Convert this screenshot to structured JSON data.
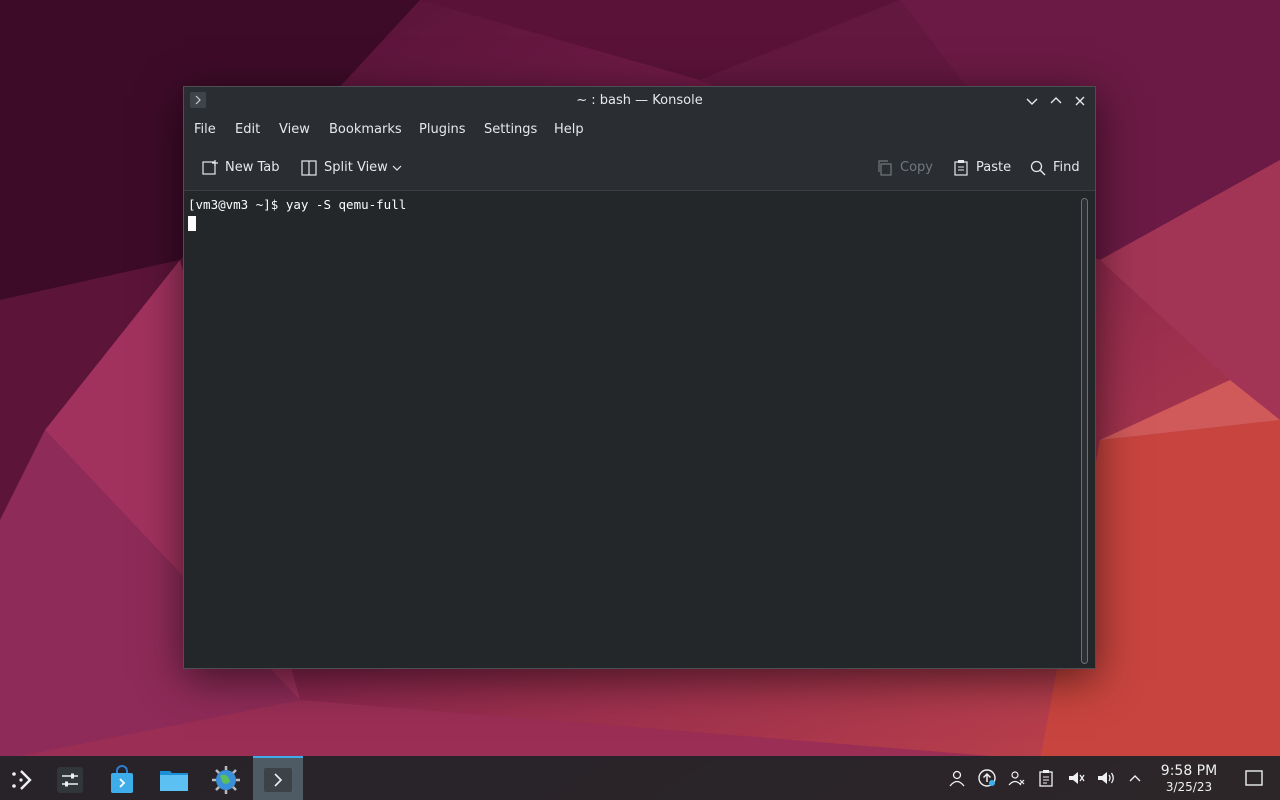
{
  "window": {
    "title": "~ : bash — Konsole"
  },
  "menubar": {
    "items": [
      "File",
      "Edit",
      "View",
      "Bookmarks",
      "Plugins",
      "Settings",
      "Help"
    ]
  },
  "toolbar": {
    "new_tab": "New Tab",
    "split_view": "Split View",
    "copy": "Copy",
    "paste": "Paste",
    "find": "Find"
  },
  "terminal": {
    "prompt_line": "[vm3@vm3 ~]$ yay -S qemu-full"
  },
  "taskbar": {
    "tasks": [
      {
        "icon": "application-launcher-icon"
      },
      {
        "icon": "system-settings-sliders-icon"
      },
      {
        "icon": "discover-store-icon"
      },
      {
        "icon": "dolphin-folder-icon"
      },
      {
        "icon": "web-browser-globe-icon"
      },
      {
        "icon": "konsole-terminal-icon",
        "active": true
      }
    ],
    "clock": {
      "time": "9:58 PM",
      "date": "3/25/23"
    }
  },
  "colors": {
    "accent": "#3daee9",
    "window_bg": "#232729",
    "chrome_bg": "#2a2e32",
    "panel_bg": "#202327"
  }
}
